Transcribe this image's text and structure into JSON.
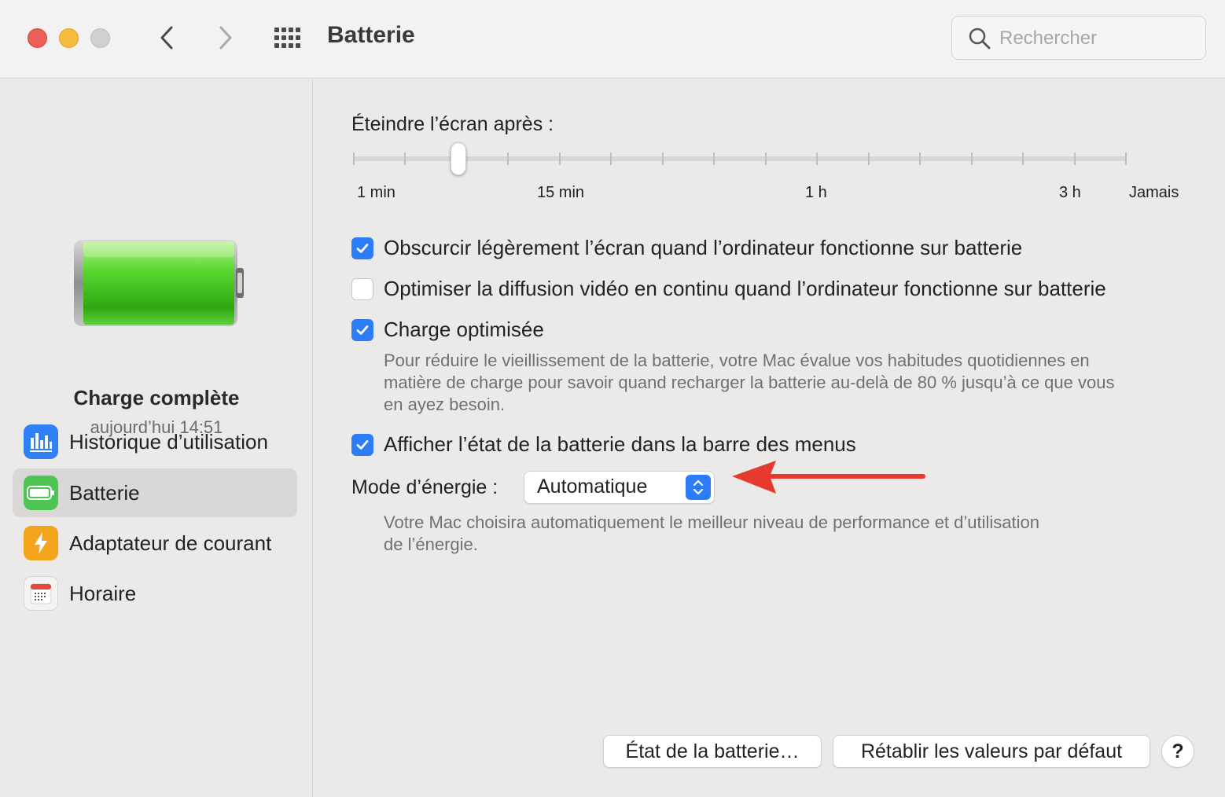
{
  "window": {
    "title": "Batterie"
  },
  "search": {
    "placeholder": "Rechercher"
  },
  "sidebar": {
    "battery_status": "Charge complète",
    "battery_time": "aujourd’hui 14:51",
    "items": [
      {
        "label": "Historique d’utilisation",
        "icon": "usage-chart-icon",
        "color": "#2f7ff5",
        "selected": false
      },
      {
        "label": "Batterie",
        "icon": "battery-icon",
        "color": "#4cc552",
        "selected": true
      },
      {
        "label": "Adaptateur de courant",
        "icon": "lightning-icon",
        "color": "#f3a31c",
        "selected": false
      },
      {
        "label": "Horaire",
        "icon": "calendar-icon",
        "color": "#f4f3f1",
        "selected": false
      }
    ]
  },
  "display_sleep": {
    "title": "Éteindre l’écran après :",
    "labels": [
      "1 min",
      "15 min",
      "1 h",
      "3 h",
      "Jamais"
    ],
    "selected_tick_index": 2,
    "tick_count": 16
  },
  "options": [
    {
      "label": "Obscurcir légèrement l’écran quand l’ordinateur fonctionne sur batterie",
      "checked": true
    },
    {
      "label": "Optimiser la diffusion vidéo en continu quand l’ordinateur fonctionne sur batterie",
      "checked": false
    },
    {
      "label": "Charge optimisée",
      "checked": true
    },
    {
      "label": "Afficher l’état de la batterie dans la barre des menus",
      "checked": true
    }
  ],
  "optimized_charging_desc": [
    "Pour réduire le vieillissement de la batterie, votre Mac évalue vos habitudes quotidiennes en",
    "matière de charge pour savoir quand recharger la batterie au-delà de 80 % jusqu’à ce que vous",
    "en ayez besoin."
  ],
  "energy_mode": {
    "label": "Mode d’énergie :",
    "value": "Automatique",
    "desc": [
      "Votre Mac choisira automatiquement le meilleur niveau de performance et d’utilisation",
      "de l’énergie."
    ]
  },
  "buttons": {
    "battery_health": "État de la batterie…",
    "restore_defaults": "Rétablir les valeurs par défaut",
    "help": "?"
  },
  "colors": {
    "accent": "#2c7cf6",
    "annotation_arrow": "#e53a2d",
    "close": "#ec5f56",
    "minimize": "#f4bd3e"
  }
}
